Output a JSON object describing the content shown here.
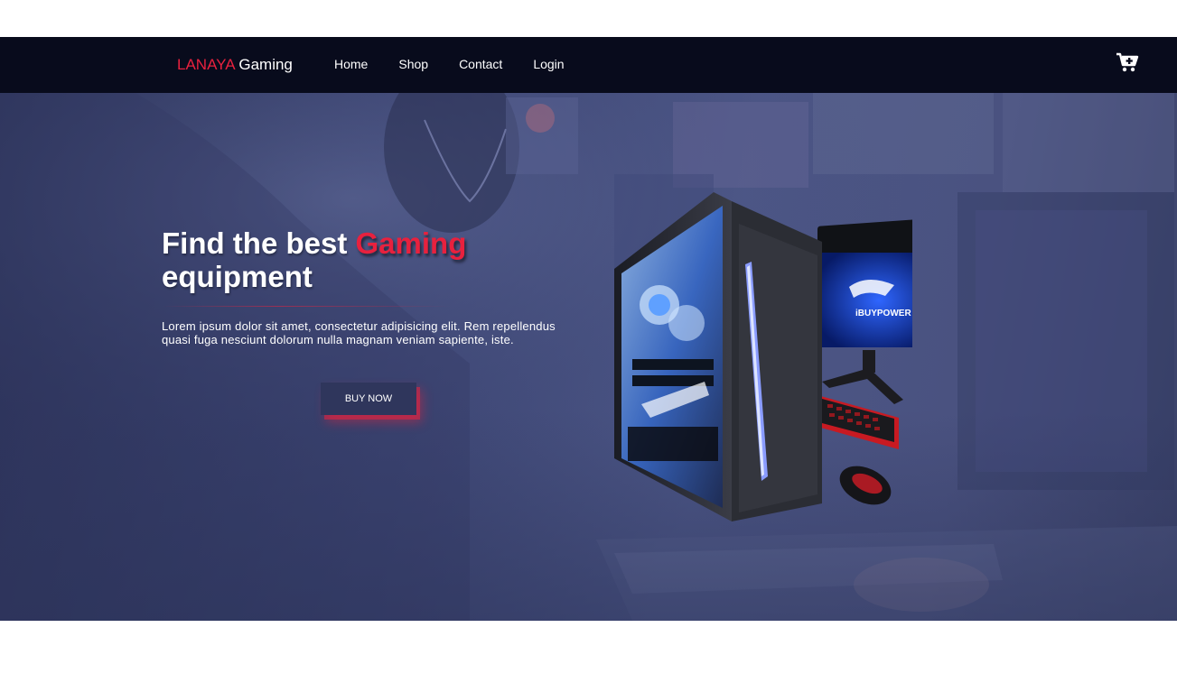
{
  "navbar": {
    "brand_accent": "LANAYA",
    "brand_rest": " Gaming",
    "links": [
      {
        "label": "Home"
      },
      {
        "label": "Shop"
      },
      {
        "label": "Contact"
      },
      {
        "label": "Login"
      }
    ],
    "cart_icon": "cart-icon"
  },
  "hero": {
    "title_part1": "Find the best ",
    "title_accent": "Gaming",
    "title_part2": "equipment",
    "description": "Lorem ipsum dolor sit amet, consectetur adipisicing elit. Rem repellendus quasi fuga nesciunt dolorum nulla magnam veniam sapiente, iste.",
    "button_label": "BUY NOW",
    "monitor_brand": "iBUYPOWER"
  },
  "colors": {
    "accent": "#e8213e",
    "navbar_bg": "#080b1c",
    "hero_bg": "#3c4573"
  }
}
